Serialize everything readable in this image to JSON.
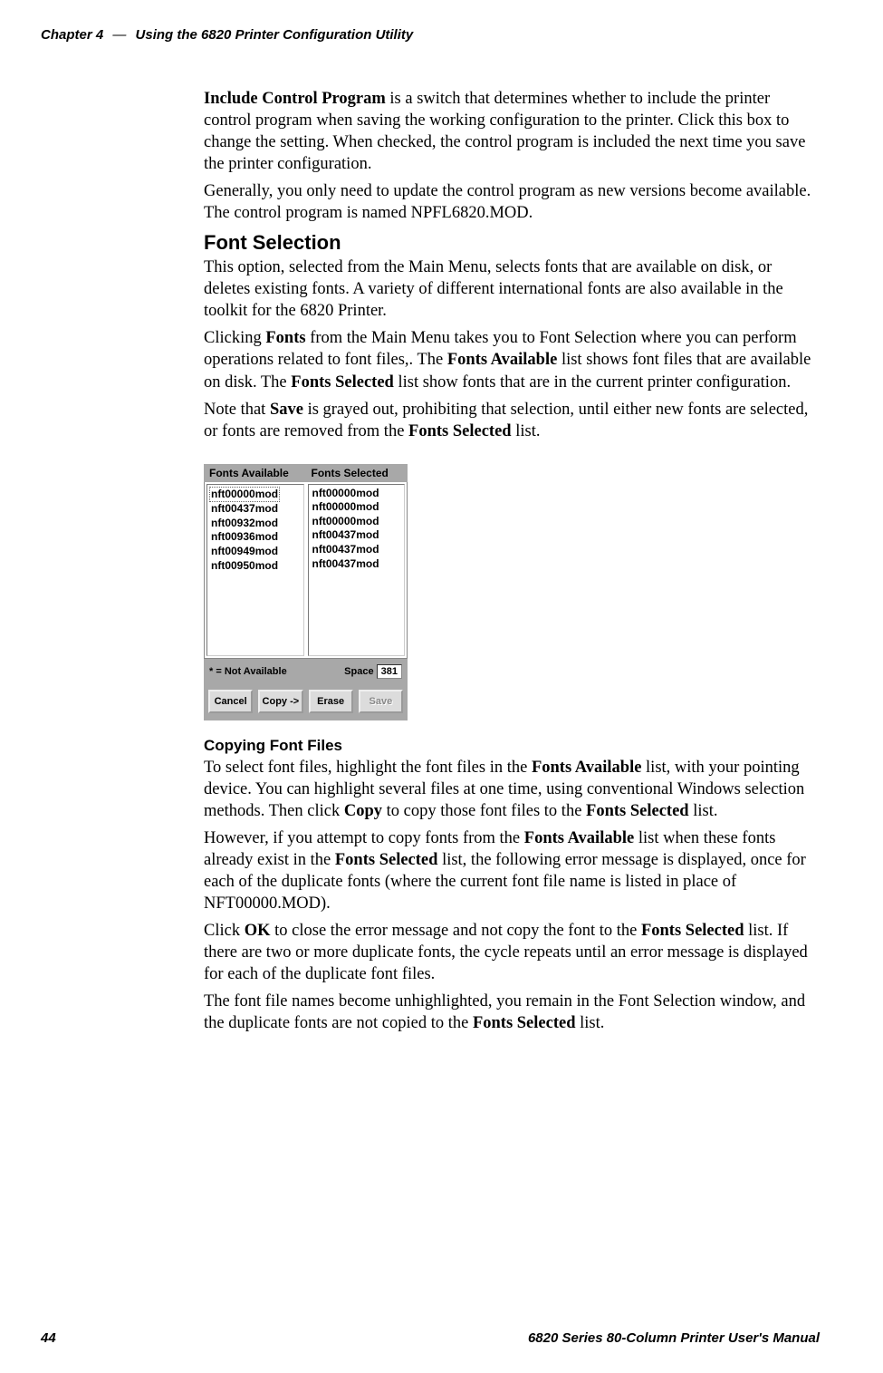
{
  "header": {
    "chapter_label": "Chapter 4",
    "dash": "—",
    "chapter_title": "Using the 6820 Printer Configuration Utility"
  },
  "paragraphs": {
    "p1a": "Include Control Program",
    "p1b": " is a switch that determines whether to include the printer control program when saving the working configuration to the printer. Click this box to change the setting. When checked, the control program is included the next time you save the printer configuration.",
    "p2": "Generally, you only need to update the control program as new versions become available. The control program is named NPFL6820.MOD.",
    "h1": "Font Selection",
    "p3": "This option, selected from the Main Menu, selects fonts that are available on disk, or deletes existing fonts. A variety of different international fonts are also available in the toolkit for the 6820 Printer.",
    "p4a": "Clicking ",
    "p4b": "Fonts",
    "p4c": " from the Main Menu takes you to Font Selection where you can perform operations related to font files,. The ",
    "p4d": "Fonts Available",
    "p4e": " list shows font files that are available on disk. The ",
    "p4f": "Fonts Selected",
    "p4g": " list show fonts that are in the current printer configuration.",
    "p5a": "Note that ",
    "p5b": "Save",
    "p5c": " is grayed out, prohibiting that selection, until either new fonts are selected, or fonts are removed from the ",
    "p5d": "Fonts Selected",
    "p5e": " list.",
    "h2": "Copying Font Files",
    "p6a": "To select font files, highlight the font files in the ",
    "p6b": "Fonts Available",
    "p6c": " list, with your pointing device. You can highlight several files at one time, using conventional Windows selection methods. Then click ",
    "p6d": "Copy",
    "p6e": "  to copy those font files to the ",
    "p6f": "Fonts Selected",
    "p6g": " list.",
    "p7a": "However, if you attempt to copy fonts from the ",
    "p7b": "Fonts Available",
    "p7c": " list when these fonts already exist in the ",
    "p7d": "Fonts Selected",
    "p7e": " list, the following error message is displayed, once for each of the duplicate fonts (where the current font file name is listed in place of NFT00000.MOD).",
    "p8a": "Click ",
    "p8b": "OK",
    "p8c": " to close the error message and not copy the font to the ",
    "p8d": "Fonts Selected",
    "p8e": " list. If there are two or more duplicate fonts, the cycle repeats until an error message is displayed for each of the duplicate font files.",
    "p9a": "The font file names become unhighlighted, you remain in the Font Selection window, and the duplicate fonts are not copied to the ",
    "p9b": "Fonts Selected",
    "p9c": " list."
  },
  "ui": {
    "header_available": "Fonts Available",
    "header_selected": "Fonts Selected",
    "available": [
      "nft00000mod",
      "nft00437mod",
      "nft00932mod",
      "nft00936mod",
      "nft00949mod",
      "nft00950mod"
    ],
    "selected": [
      "nft00000mod",
      "nft00000mod",
      "nft00000mod",
      "nft00437mod",
      "nft00437mod",
      "nft00437mod"
    ],
    "not_available_label": "* = Not Available",
    "space_label": "Space",
    "space_value": "381",
    "btn_cancel": "Cancel",
    "btn_copy": "Copy ->",
    "btn_erase": "Erase",
    "btn_save": "Save"
  },
  "footer": {
    "page": "44",
    "manual": "6820 Series 80-Column Printer User's Manual"
  }
}
